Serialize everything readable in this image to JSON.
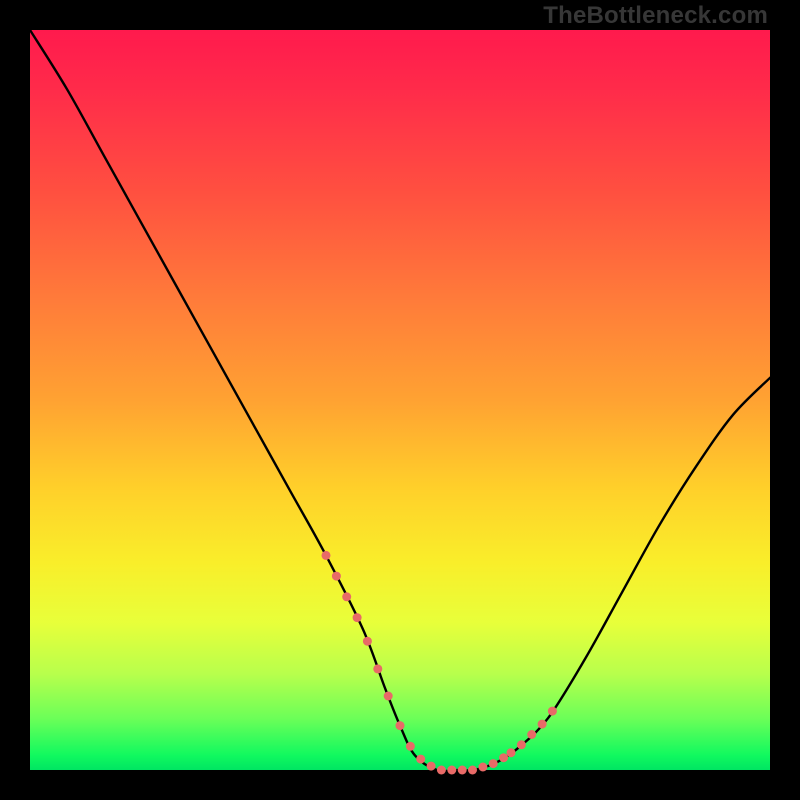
{
  "watermark": "TheBottleneck.com",
  "chart_data": {
    "type": "line",
    "title": "",
    "xlabel": "",
    "ylabel": "",
    "xlim": [
      0,
      100
    ],
    "ylim": [
      0,
      100
    ],
    "grid": false,
    "legend": false,
    "series": [
      {
        "name": "bottleneck-curve",
        "x": [
          0,
          5,
          10,
          15,
          20,
          25,
          30,
          35,
          40,
          45,
          48,
          50,
          52,
          55,
          58,
          60,
          63,
          66,
          70,
          75,
          80,
          85,
          90,
          95,
          100
        ],
        "y": [
          100,
          92,
          83,
          74,
          65,
          56,
          47,
          38,
          29,
          19,
          11,
          6,
          2,
          0,
          0,
          0,
          1,
          3,
          7,
          15,
          24,
          33,
          41,
          48,
          53
        ]
      }
    ],
    "highlight_segments": [
      {
        "x_from": 40,
        "x_to": 49,
        "note": "left shoulder dotted pink"
      },
      {
        "x_from": 50,
        "x_to": 64,
        "note": "valley floor dotted pink"
      },
      {
        "x_from": 65,
        "x_to": 72,
        "note": "right shoulder dotted pink"
      }
    ],
    "colors": {
      "curve": "#000000",
      "highlight": "#e86a67",
      "gradient_top": "#ff1a4d",
      "gradient_bottom": "#00e562"
    }
  }
}
